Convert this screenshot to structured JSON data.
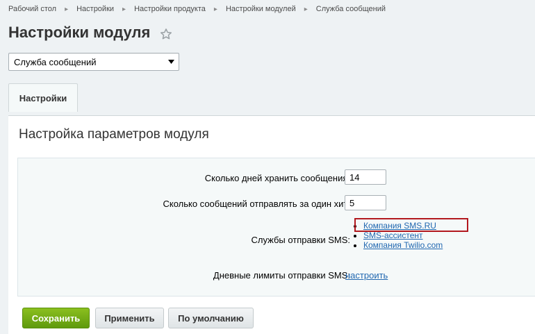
{
  "breadcrumb": [
    "Рабочий стол",
    "Настройки",
    "Настройки продукта",
    "Настройки модулей",
    "Служба сообщений"
  ],
  "page_title": "Настройки модуля",
  "module_select": {
    "value": "Служба сообщений"
  },
  "tabs": [
    {
      "label": "Настройки"
    }
  ],
  "panel": {
    "title": "Настройка параметров модуля",
    "fields": {
      "days_label": "Сколько дней хранить сообщения:",
      "days_value": "14",
      "per_hit_label": "Сколько сообщений отправлять за один хит:",
      "per_hit_value": "5",
      "sms_services_label": "Службы отправки SMS:",
      "sms_services": [
        "Компания SMS.RU",
        "SMS-ассистент",
        "Компания Twilio.com"
      ],
      "daily_limits_label": "Дневные лимиты отправки SMS:",
      "daily_limits_link": "настроить"
    }
  },
  "buttons": {
    "save": "Сохранить",
    "apply": "Применить",
    "default": "По умолчанию"
  },
  "colors": {
    "accent_green": "#6aa815",
    "link": "#2067b0",
    "highlight": "#b2181e"
  },
  "icons": {
    "favorite": "star-icon",
    "dropdown": "triangle-down-icon"
  }
}
